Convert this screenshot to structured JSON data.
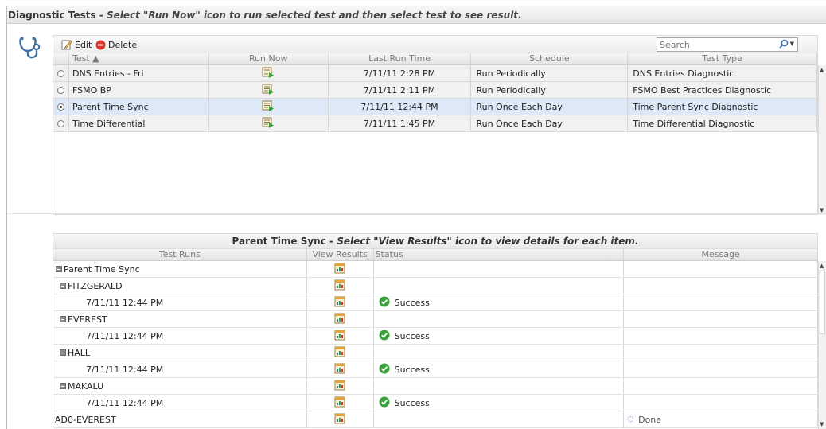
{
  "header": {
    "title": "Diagnostic Tests",
    "separator": " - ",
    "instruction": "Select \"Run Now\" icon to run selected test and then select test to see result."
  },
  "toolbar": {
    "edit_label": "Edit",
    "delete_label": "Delete",
    "search_placeholder": "Search"
  },
  "tests_grid": {
    "columns": [
      "Test ▲",
      "Run Now",
      "Last Run Time",
      "Schedule",
      "Test Type"
    ],
    "rows": [
      {
        "name": "DNS Entries - Fri",
        "last_run": "7/11/11 2:28 PM",
        "schedule": "Run Periodically",
        "type": "DNS Entries Diagnostic",
        "selected": false
      },
      {
        "name": "FSMO BP",
        "last_run": "7/11/11 2:11 PM",
        "schedule": "Run Periodically",
        "type": "FSMO Best Practices Diagnostic",
        "selected": false
      },
      {
        "name": "Parent Time Sync",
        "last_run": "7/11/11 12:44 PM",
        "schedule": "Run Once Each Day",
        "type": "Time Parent Sync Diagnostic",
        "selected": true
      },
      {
        "name": "Time Differential",
        "last_run": "7/11/11 1:45 PM",
        "schedule": "Run Once Each Day",
        "type": "Time Differential Diagnostic",
        "selected": false
      }
    ]
  },
  "results_panel": {
    "title": "Parent Time Sync",
    "separator": " - ",
    "instruction": "Select \"View Results\" icon to view details for each item.",
    "columns": [
      "Test Runs",
      "View Results",
      "Status",
      "Message"
    ],
    "rows": [
      {
        "label": "Parent Time Sync",
        "level": 0,
        "status": "",
        "message": ""
      },
      {
        "label": "FITZGERALD",
        "level": 1,
        "status": "",
        "message": ""
      },
      {
        "label": "7/11/11 12:44 PM",
        "level": 2,
        "status": "Success",
        "message": ""
      },
      {
        "label": "EVEREST",
        "level": 1,
        "status": "",
        "message": ""
      },
      {
        "label": "7/11/11 12:44 PM",
        "level": 2,
        "status": "Success",
        "message": ""
      },
      {
        "label": "HALL",
        "level": 1,
        "status": "",
        "message": ""
      },
      {
        "label": "7/11/11 12:44 PM",
        "level": 2,
        "status": "Success",
        "message": ""
      },
      {
        "label": "MAKALU",
        "level": 1,
        "status": "",
        "message": ""
      },
      {
        "label": "7/11/11 12:44 PM",
        "level": 2,
        "status": "Success",
        "message": ""
      },
      {
        "label": "AD0-EVEREST",
        "level": 2,
        "status": "",
        "message": "Done"
      }
    ]
  },
  "colors": {
    "selected_row": "#dde9f7",
    "row_bg": "#f1f1f1",
    "success_green": "#3aa13a",
    "delete_red": "#d9352b"
  },
  "icons": {
    "edit": "pencil-edit-icon",
    "delete": "red-minus-delete-icon",
    "search": "magnifier-icon",
    "run_now": "run-now-icon",
    "view_results": "view-results-icon",
    "success": "green-check-icon",
    "app": "stethoscope-icon"
  }
}
